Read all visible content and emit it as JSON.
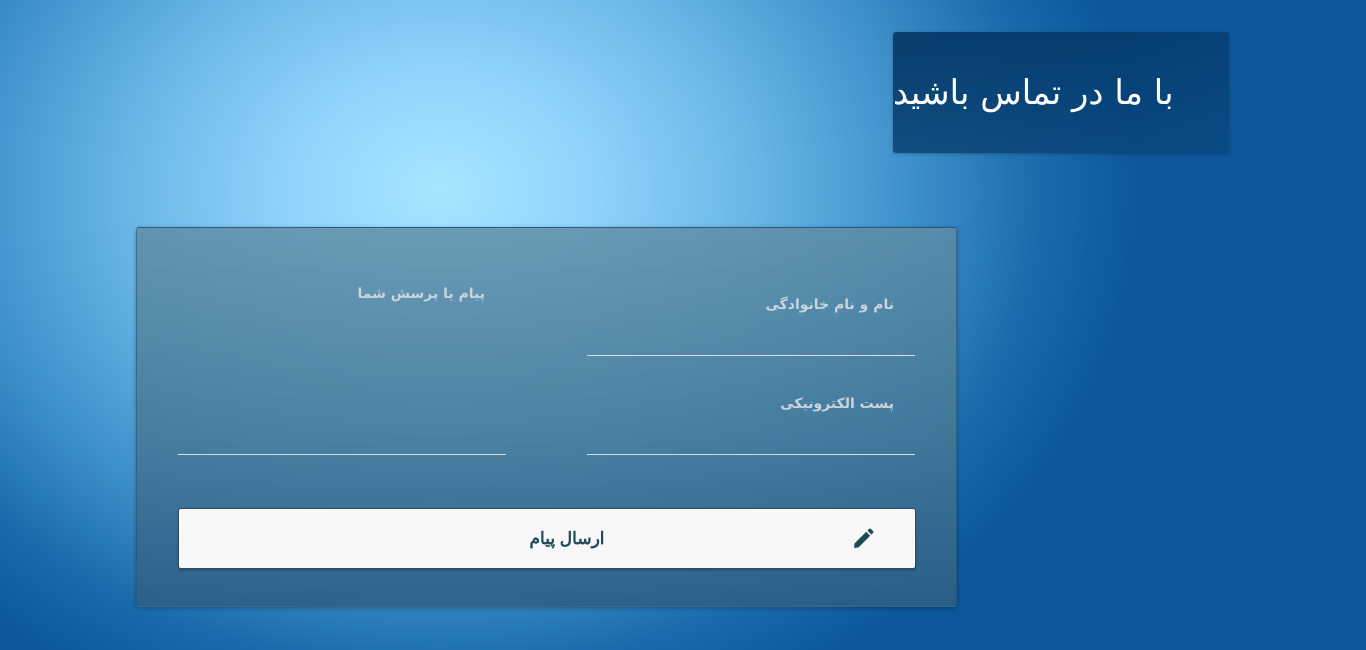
{
  "header": {
    "title": "با ما در تماس باشید"
  },
  "form": {
    "name_label": "نام و نام خانوادگی",
    "name_value": "",
    "email_label": "پست الکترونیکی",
    "email_value": "",
    "message_label": "پیام یا پرسش شما",
    "message_value": "",
    "submit_label": "ارسال پیام",
    "submit_icon": "pencil-icon"
  },
  "colors": {
    "button_text": "#1f4a5a",
    "label_text": "#c7d5df"
  }
}
